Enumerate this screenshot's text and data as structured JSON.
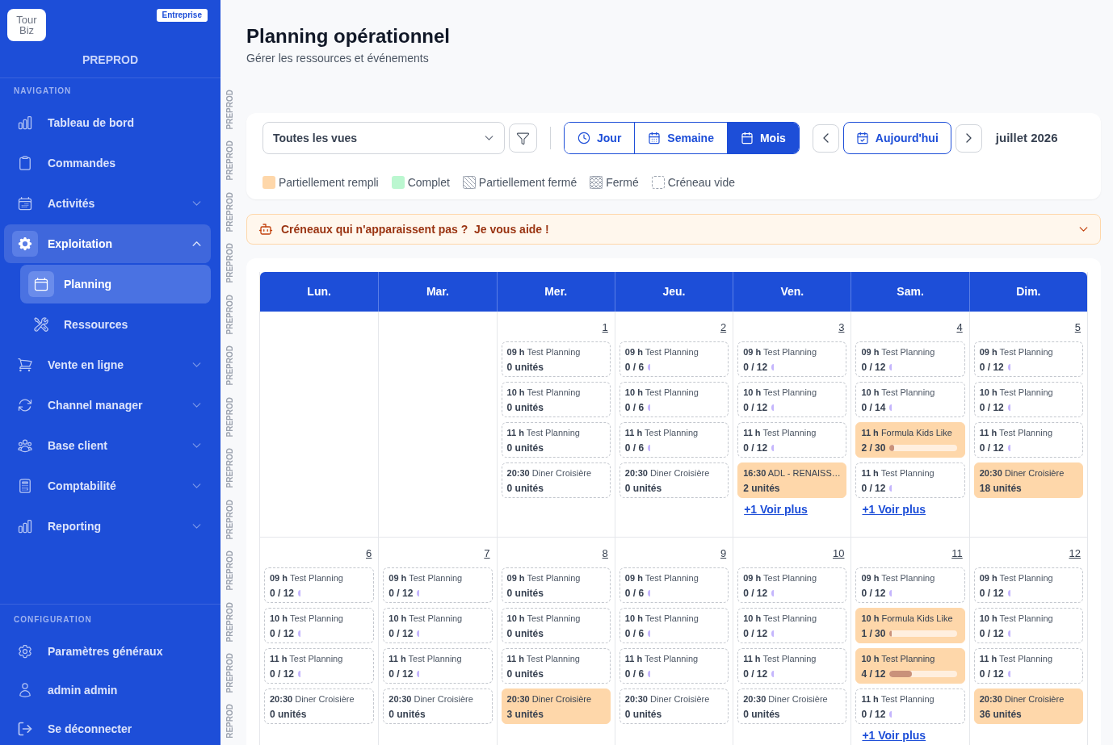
{
  "sidebar": {
    "logo_lines": [
      "Tour",
      "Biz"
    ],
    "plan_badge": "Entreprise",
    "environment": "PREPROD",
    "sections": [
      {
        "title": "NAVIGATION",
        "items": [
          {
            "label": "Tableau de bord",
            "kind": "link",
            "selected": false
          },
          {
            "label": "Commandes",
            "kind": "link",
            "selected": false
          },
          {
            "label": "Activités",
            "kind": "group",
            "expanded": false,
            "selected": false
          },
          {
            "label": "Exploitation",
            "kind": "group",
            "expanded": true,
            "selected": true,
            "children": [
              {
                "label": "Planning",
                "kind": "link",
                "selected": true
              },
              {
                "label": "Ressources",
                "kind": "link",
                "selected": false
              }
            ]
          },
          {
            "label": "Vente en ligne",
            "kind": "group",
            "expanded": false,
            "selected": false
          },
          {
            "label": "Channel manager",
            "kind": "group",
            "expanded": false,
            "selected": false
          },
          {
            "label": "Base client",
            "kind": "group",
            "expanded": false,
            "selected": false
          },
          {
            "label": "Comptabilité",
            "kind": "group",
            "expanded": false,
            "selected": false
          },
          {
            "label": "Reporting",
            "kind": "group",
            "expanded": false,
            "selected": false
          }
        ]
      },
      {
        "title": "CONFIGURATION",
        "items": [
          {
            "label": "Paramètres généraux",
            "kind": "link",
            "selected": false
          },
          {
            "label": "admin admin",
            "kind": "link",
            "selected": false
          },
          {
            "label": "Se déconnecter",
            "kind": "link",
            "selected": false
          }
        ]
      }
    ]
  },
  "environment_stripe": [
    "PREPROD",
    "PREPROD",
    "PREPROD",
    "PREPROD",
    "PREPROD",
    "PREPROD",
    "PREPROD",
    "PREPROD",
    "PREPROD",
    "PREPROD",
    "PREPROD",
    "PREPROD",
    "REPROD"
  ],
  "header": {
    "title": "Planning opérationnel",
    "subtitle": "Gérer les ressources et événements"
  },
  "toolbar": {
    "view_select": {
      "value": "Toutes les vues"
    },
    "view_modes": [
      {
        "label": "Jour",
        "selected": false
      },
      {
        "label": "Semaine",
        "selected": false
      },
      {
        "label": "Mois",
        "selected": true
      }
    ],
    "today_button": "Aujourd'hui",
    "period": "juillet 2026",
    "legend": [
      {
        "kind": "partial",
        "label": "Partiellement rempli",
        "color": "#fed7aa"
      },
      {
        "kind": "full",
        "label": "Complet",
        "color": "#bbf7d0"
      },
      {
        "kind": "partially_closed",
        "label": "Partiellement fermé"
      },
      {
        "kind": "closed",
        "label": "Fermé"
      },
      {
        "kind": "empty",
        "label": "Créneau vide"
      }
    ]
  },
  "help_banner": {
    "text": "Créneaux qui n'apparaissent pas ?  Je vous aide !",
    "expanded": false
  },
  "calendar": {
    "weekdays": [
      "Lun.",
      "Mar.",
      "Mer.",
      "Jeu.",
      "Ven.",
      "Sam.",
      "Dim."
    ],
    "weeks": [
      {
        "days": [
          {
            "kind": "blank"
          },
          {
            "kind": "blank"
          },
          {
            "kind": "day",
            "date": "1",
            "events": [
              {
                "time": "09 h",
                "title": "Test Planning",
                "partially_filled": false,
                "kind": "units",
                "quantity": "0 unités"
              },
              {
                "time": "10 h",
                "title": "Test Planning",
                "partially_filled": false,
                "kind": "units",
                "quantity": "0 unités"
              },
              {
                "time": "11 h",
                "title": "Test Planning",
                "partially_filled": false,
                "kind": "units",
                "quantity": "0 unités"
              },
              {
                "time": "20:30",
                "title": "Diner Croisière",
                "partially_filled": false,
                "kind": "units",
                "quantity": "0 unités"
              }
            ]
          },
          {
            "kind": "day",
            "date": "2",
            "events": [
              {
                "time": "09 h",
                "title": "Test Planning",
                "partially_filled": false,
                "kind": "capacity",
                "quantity": "0 / 6"
              },
              {
                "time": "10 h",
                "title": "Test Planning",
                "partially_filled": false,
                "kind": "capacity",
                "quantity": "0 / 6"
              },
              {
                "time": "11 h",
                "title": "Test Planning",
                "partially_filled": false,
                "kind": "capacity",
                "quantity": "0 / 6"
              },
              {
                "time": "20:30",
                "title": "Diner Croisière",
                "partially_filled": false,
                "kind": "units",
                "quantity": "0 unités"
              }
            ]
          },
          {
            "kind": "day",
            "date": "3",
            "events": [
              {
                "time": "09 h",
                "title": "Test Planning",
                "partially_filled": false,
                "kind": "capacity",
                "quantity": "0 / 12"
              },
              {
                "time": "10 h",
                "title": "Test Planning",
                "partially_filled": false,
                "kind": "capacity",
                "quantity": "0 / 12"
              },
              {
                "time": "11 h",
                "title": "Test Planning",
                "partially_filled": false,
                "kind": "capacity",
                "quantity": "0 / 12"
              },
              {
                "time": "16:30",
                "title": "ADL - RENAISS…",
                "partially_filled": true,
                "kind": "units",
                "quantity": "2 unités"
              }
            ],
            "more_link": "+1 Voir plus"
          },
          {
            "kind": "day",
            "date": "4",
            "events": [
              {
                "time": "09 h",
                "title": "Test Planning",
                "partially_filled": false,
                "kind": "capacity",
                "quantity": "0 / 12"
              },
              {
                "time": "10 h",
                "title": "Test Planning",
                "partially_filled": false,
                "kind": "capacity",
                "quantity": "0 / 14"
              },
              {
                "time": "11 h",
                "title": "Formula Kids Like",
                "partially_filled": true,
                "kind": "capacity",
                "quantity": "2 / 30",
                "level": 0.067
              },
              {
                "time": "11 h",
                "title": "Test Planning",
                "partially_filled": false,
                "kind": "capacity",
                "quantity": "0 / 12"
              }
            ],
            "more_link": "+1 Voir plus"
          },
          {
            "kind": "day",
            "date": "5",
            "events": [
              {
                "time": "09 h",
                "title": "Test Planning",
                "partially_filled": false,
                "kind": "capacity",
                "quantity": "0 / 12"
              },
              {
                "time": "10 h",
                "title": "Test Planning",
                "partially_filled": false,
                "kind": "capacity",
                "quantity": "0 / 12"
              },
              {
                "time": "11 h",
                "title": "Test Planning",
                "partially_filled": false,
                "kind": "capacity",
                "quantity": "0 / 12"
              },
              {
                "time": "20:30",
                "title": "Diner Croisière",
                "partially_filled": true,
                "kind": "units",
                "quantity": "18 unités"
              }
            ]
          }
        ]
      },
      {
        "days": [
          {
            "kind": "day",
            "date": "6",
            "events": [
              {
                "time": "09 h",
                "title": "Test Planning",
                "partially_filled": false,
                "kind": "capacity",
                "quantity": "0 / 12"
              },
              {
                "time": "10 h",
                "title": "Test Planning",
                "partially_filled": false,
                "kind": "capacity",
                "quantity": "0 / 12"
              },
              {
                "time": "11 h",
                "title": "Test Planning",
                "partially_filled": false,
                "kind": "capacity",
                "quantity": "0 / 12"
              },
              {
                "time": "20:30",
                "title": "Diner Croisière",
                "partially_filled": false,
                "kind": "units",
                "quantity": "0 unités"
              }
            ]
          },
          {
            "kind": "day",
            "date": "7",
            "events": [
              {
                "time": "09 h",
                "title": "Test Planning",
                "partially_filled": false,
                "kind": "capacity",
                "quantity": "0 / 12"
              },
              {
                "time": "10 h",
                "title": "Test Planning",
                "partially_filled": false,
                "kind": "capacity",
                "quantity": "0 / 12"
              },
              {
                "time": "11 h",
                "title": "Test Planning",
                "partially_filled": false,
                "kind": "capacity",
                "quantity": "0 / 12"
              },
              {
                "time": "20:30",
                "title": "Diner Croisière",
                "partially_filled": false,
                "kind": "units",
                "quantity": "0 unités"
              }
            ]
          },
          {
            "kind": "day",
            "date": "8",
            "events": [
              {
                "time": "09 h",
                "title": "Test Planning",
                "partially_filled": false,
                "kind": "units",
                "quantity": "0 unités"
              },
              {
                "time": "10 h",
                "title": "Test Planning",
                "partially_filled": false,
                "kind": "units",
                "quantity": "0 unités"
              },
              {
                "time": "11 h",
                "title": "Test Planning",
                "partially_filled": false,
                "kind": "units",
                "quantity": "0 unités"
              },
              {
                "time": "20:30",
                "title": "Diner Croisière",
                "partially_filled": true,
                "kind": "units",
                "quantity": "3 unités"
              }
            ]
          },
          {
            "kind": "day",
            "date": "9",
            "events": [
              {
                "time": "09 h",
                "title": "Test Planning",
                "partially_filled": false,
                "kind": "capacity",
                "quantity": "0 / 6"
              },
              {
                "time": "10 h",
                "title": "Test Planning",
                "partially_filled": false,
                "kind": "capacity",
                "quantity": "0 / 6"
              },
              {
                "time": "11 h",
                "title": "Test Planning",
                "partially_filled": false,
                "kind": "capacity",
                "quantity": "0 / 6"
              },
              {
                "time": "20:30",
                "title": "Diner Croisière",
                "partially_filled": false,
                "kind": "units",
                "quantity": "0 unités"
              }
            ]
          },
          {
            "kind": "day",
            "date": "10",
            "events": [
              {
                "time": "09 h",
                "title": "Test Planning",
                "partially_filled": false,
                "kind": "capacity",
                "quantity": "0 / 12"
              },
              {
                "time": "10 h",
                "title": "Test Planning",
                "partially_filled": false,
                "kind": "capacity",
                "quantity": "0 / 12"
              },
              {
                "time": "11 h",
                "title": "Test Planning",
                "partially_filled": false,
                "kind": "capacity",
                "quantity": "0 / 12"
              },
              {
                "time": "20:30",
                "title": "Diner Croisière",
                "partially_filled": false,
                "kind": "units",
                "quantity": "0 unités"
              }
            ]
          },
          {
            "kind": "day",
            "date": "11",
            "events": [
              {
                "time": "09 h",
                "title": "Test Planning",
                "partially_filled": false,
                "kind": "capacity",
                "quantity": "0 / 12"
              },
              {
                "time": "10 h",
                "title": "Formula Kids Like",
                "partially_filled": true,
                "kind": "capacity",
                "quantity": "1 / 30",
                "level": 0.033
              },
              {
                "time": "10 h",
                "title": "Test Planning",
                "partially_filled": true,
                "kind": "capacity",
                "quantity": "4 / 12",
                "level": 0.333
              },
              {
                "time": "11 h",
                "title": "Test Planning",
                "partially_filled": false,
                "kind": "capacity",
                "quantity": "0 / 12"
              }
            ],
            "more_link": "+1 Voir plus"
          },
          {
            "kind": "day",
            "date": "12",
            "events": [
              {
                "time": "09 h",
                "title": "Test Planning",
                "partially_filled": false,
                "kind": "capacity",
                "quantity": "0 / 12"
              },
              {
                "time": "10 h",
                "title": "Test Planning",
                "partially_filled": false,
                "kind": "capacity",
                "quantity": "0 / 12"
              },
              {
                "time": "11 h",
                "title": "Test Planning",
                "partially_filled": false,
                "kind": "capacity",
                "quantity": "0 / 12"
              },
              {
                "time": "20:30",
                "title": "Diner Croisière",
                "partially_filled": true,
                "kind": "units",
                "quantity": "36 unités"
              }
            ]
          }
        ]
      }
    ]
  }
}
